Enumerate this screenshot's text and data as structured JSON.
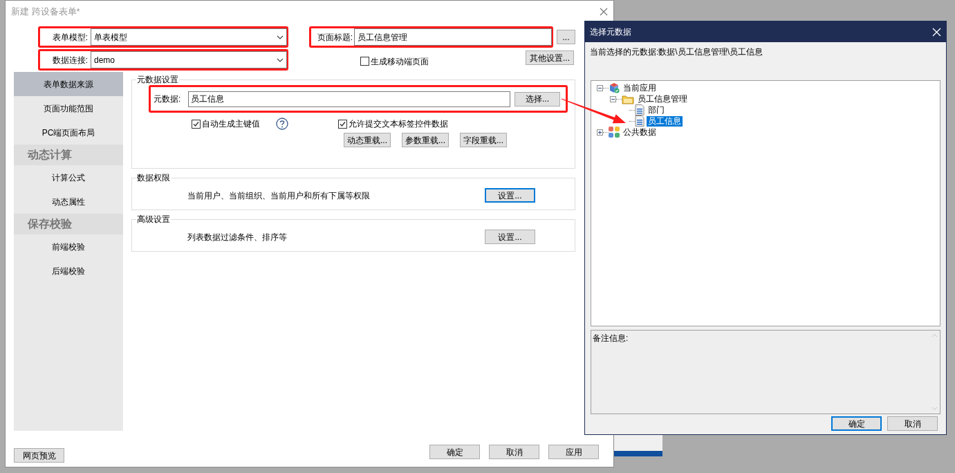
{
  "main_window": {
    "title": "新建 跨设备表单*",
    "form_model": {
      "label": "表单模型:",
      "value": "单表模型",
      "highlighted": true
    },
    "page_title": {
      "label": "页面标题:",
      "value": "员工信息管理",
      "highlighted": true
    },
    "ellipsis_button": "...",
    "data_connection": {
      "label": "数据连接:",
      "value": "demo",
      "highlighted": true
    },
    "mobile_page": {
      "label": "生成移动端页面",
      "checked": false
    },
    "other_settings_button": "其他设置...",
    "nav": [
      {
        "kind": "item",
        "label": "表单数据来源",
        "selected": true
      },
      {
        "kind": "item",
        "label": "页面功能范围",
        "selected": false
      },
      {
        "kind": "item",
        "label": "PC端页面布局",
        "selected": false
      },
      {
        "kind": "header",
        "label": "动态计算"
      },
      {
        "kind": "item",
        "label": "计算公式",
        "selected": false
      },
      {
        "kind": "item",
        "label": "动态属性",
        "selected": false
      },
      {
        "kind": "header",
        "label": "保存校验"
      },
      {
        "kind": "item",
        "label": "前端校验",
        "selected": false
      },
      {
        "kind": "item",
        "label": "后端校验",
        "selected": false
      }
    ],
    "metadata_group": {
      "title": "元数据设置",
      "label": "元数据:",
      "value": "员工信息",
      "select_button": "选择...",
      "highlighted": true,
      "checkboxes": [
        {
          "label": "自动生成主键值",
          "checked": true,
          "help": true
        },
        {
          "label": "允许提交文本标签控件数据",
          "checked": true,
          "help": false
        }
      ],
      "buttons": [
        "动态重载...",
        "参数重载...",
        "字段重载..."
      ]
    },
    "groups": [
      {
        "title": "数据权限",
        "text": "当前用户、当前组织、当前用户和所有下属等权限",
        "button": "设置...",
        "focused": true
      },
      {
        "title": "高级设置",
        "text": "列表数据过滤条件、排序等",
        "button": "设置...",
        "focused": false
      }
    ],
    "preview_button": "网页预览",
    "footer_buttons": [
      "确定",
      "取消",
      "应用"
    ]
  },
  "dialog": {
    "title": "选择元数据",
    "current_path": "当前选择的元数据:数据\\员工信息管理\\员工信息",
    "tree": [
      {
        "label": "当前应用",
        "kind": "app",
        "expanded": true,
        "selected": false,
        "children": [
          {
            "label": "员工信息管理",
            "kind": "folder",
            "expanded": true,
            "selected": false,
            "children": [
              {
                "label": "部门",
                "kind": "table",
                "selected": false
              },
              {
                "label": "员工信息",
                "kind": "table",
                "selected": true
              }
            ]
          }
        ]
      },
      {
        "label": "公共数据",
        "kind": "public",
        "expanded": false,
        "selected": false
      }
    ],
    "notes_label": "备注信息:",
    "buttons": [
      {
        "label": "确定",
        "focused": true
      },
      {
        "label": "取消",
        "focused": false
      }
    ]
  }
}
